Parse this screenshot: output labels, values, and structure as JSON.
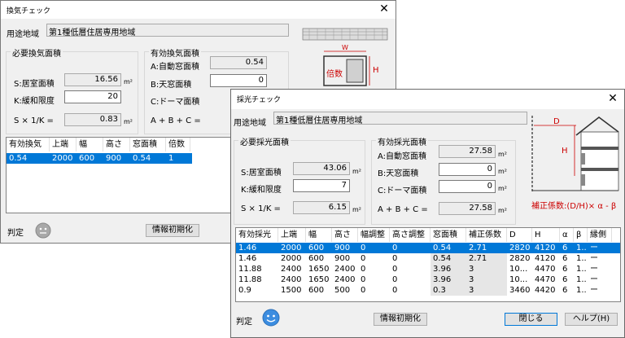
{
  "ventilation": {
    "title": "換気チェック",
    "usage_label": "用途地域",
    "usage_value": "第1種低層住居専用地域",
    "required_group": "必要換気面積",
    "floor_label": "S:居室面積",
    "floor_value": "16.56",
    "relax_label": "K:緩和限度",
    "relax_value": "20",
    "formula_label": "S × 1/K  =",
    "formula_value": "0.83",
    "effective_group": "有効換気面積",
    "auto_label": "A:自動窓面積",
    "auto_value": "0.54",
    "skylight_label": "B:天窓面積",
    "skylight_value": "0",
    "dormer_label": "C:ドーマ面積",
    "dormer_value": "",
    "sum_label": "A + B + C =",
    "unit": "m²",
    "columns": [
      "有効換気",
      "上端",
      "幅",
      "高さ",
      "窓面積",
      "倍数"
    ],
    "rows": [
      [
        "0.54",
        "2000",
        "600",
        "900",
        "0.54",
        "1"
      ]
    ],
    "judge_label": "判定",
    "init_button": "情報初期化",
    "figure": {
      "w_label": "W",
      "h_label": "H",
      "multiple_label": "倍数"
    }
  },
  "lighting": {
    "title": "採光チェック",
    "usage_label": "用途地域",
    "usage_value": "第1種低層住居専用地域",
    "required_group": "必要採光面積",
    "floor_label": "S:居室面積",
    "floor_value": "43.06",
    "relax_label": "K:緩和限度",
    "relax_value": "7",
    "formula_label": "S × 1/K  =",
    "formula_value": "6.15",
    "effective_group": "有効採光面積",
    "auto_label": "A:自動窓面積",
    "auto_value": "27.58",
    "skylight_label": "B:天窓面積",
    "skylight_value": "0",
    "dormer_label": "C:ドーマ面積",
    "dormer_value": "0",
    "sum_label": "A + B + C =",
    "sum_value": "27.58",
    "unit": "m²",
    "correction_label": "補正係数:(D/H)× α - β",
    "figure": {
      "d_label": "D",
      "h_label": "H"
    },
    "columns": [
      "有効採光",
      "上端",
      "幅",
      "高さ",
      "幅調整",
      "高さ調整",
      "窓面積",
      "補正係数",
      "D",
      "H",
      "α",
      "β",
      "縁側"
    ],
    "rows": [
      [
        "1.46",
        "2000",
        "600",
        "900",
        "0",
        "0",
        "0.54",
        "2.71",
        "2820",
        "4120",
        "6",
        "1..",
        "ー"
      ],
      [
        "1.46",
        "2000",
        "600",
        "900",
        "0",
        "0",
        "0.54",
        "2.71",
        "2820",
        "4120",
        "6",
        "1..",
        "ー"
      ],
      [
        "11.88",
        "2400",
        "1650",
        "2400",
        "0",
        "0",
        "3.96",
        "3",
        "10...",
        "4470",
        "6",
        "1..",
        "ー"
      ],
      [
        "11.88",
        "2400",
        "1650",
        "2400",
        "0",
        "0",
        "3.96",
        "3",
        "10...",
        "4470",
        "6",
        "1..",
        "ー"
      ],
      [
        "0.9",
        "1500",
        "600",
        "500",
        "0",
        "0",
        "0.3",
        "3",
        "3460",
        "4420",
        "6",
        "1..",
        "ー"
      ]
    ],
    "judge_label": "判定",
    "init_button": "情報初期化",
    "close_button": "閉じる",
    "help_button": "ヘルプ(H)"
  }
}
